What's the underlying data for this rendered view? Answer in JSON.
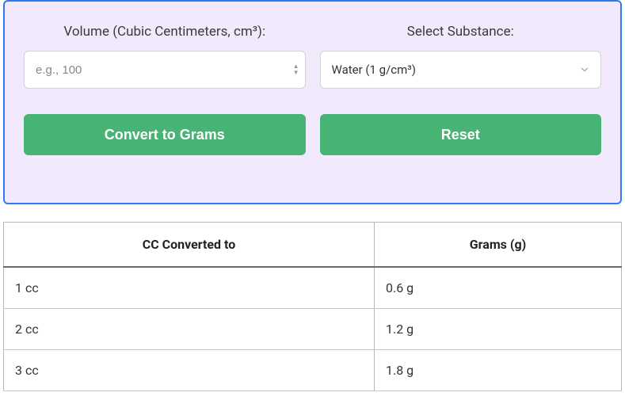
{
  "form": {
    "volume_label_html": "Volume (Cubic Centimeters, cm³):",
    "volume_placeholder": "e.g., 100",
    "volume_value": "",
    "substance_label": "Select Substance:",
    "substance_value": "Water (1 g/cm³)",
    "convert_label": "Convert to Grams",
    "reset_label": "Reset"
  },
  "table": {
    "headers": {
      "cc": "CC Converted to",
      "grams": "Grams (g)"
    },
    "rows": [
      {
        "cc": "1 cc",
        "grams": "0.6 g"
      },
      {
        "cc": "2 cc",
        "grams": "1.2 g"
      },
      {
        "cc": "3 cc",
        "grams": "1.8 g"
      }
    ]
  }
}
